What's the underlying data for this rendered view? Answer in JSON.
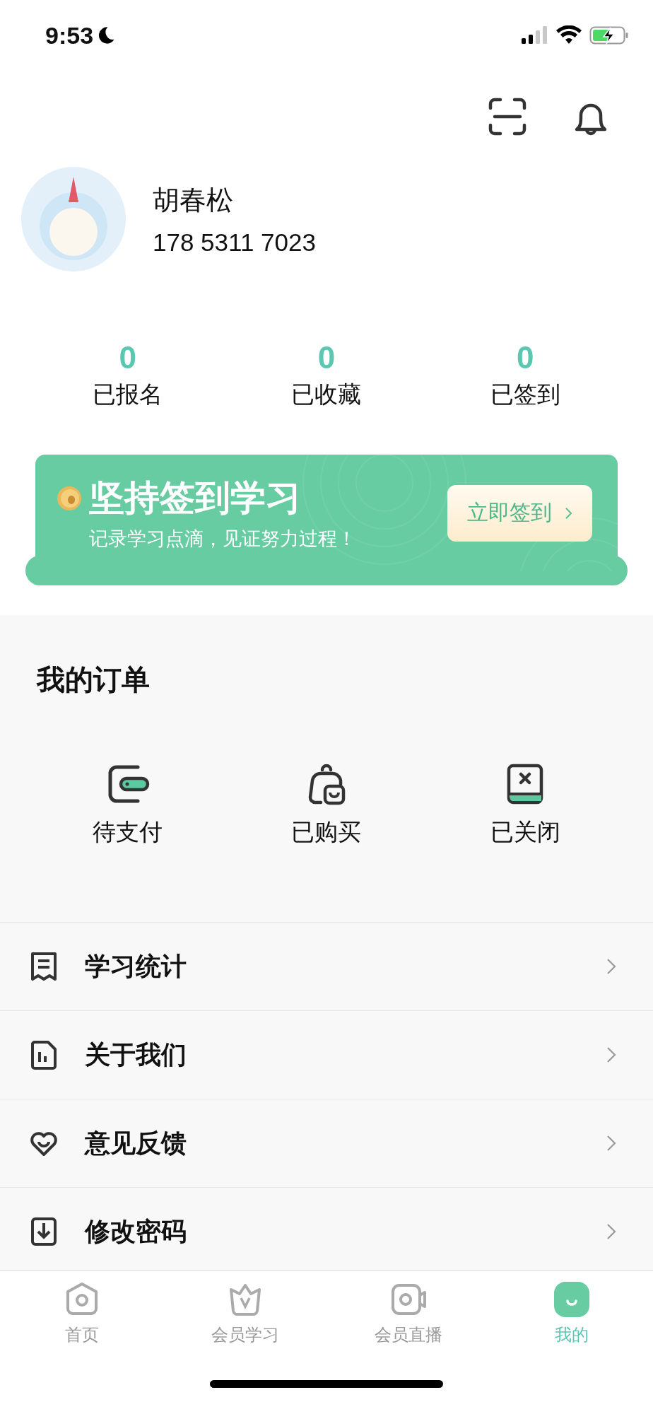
{
  "status_bar": {
    "time": "9:53"
  },
  "profile": {
    "name": "胡春松",
    "phone": "178 5311 7023"
  },
  "stats": [
    {
      "value": "0",
      "label": "已报名"
    },
    {
      "value": "0",
      "label": "已收藏"
    },
    {
      "value": "0",
      "label": "已签到"
    }
  ],
  "checkin_banner": {
    "title": "坚持签到学习",
    "subtitle": "记录学习点滴，见证努力过程！",
    "button": "立即签到"
  },
  "orders": {
    "title": "我的订单",
    "items": [
      {
        "kind": "wallet",
        "label": "待支付"
      },
      {
        "kind": "bag",
        "label": "已购买"
      },
      {
        "kind": "closed",
        "label": "已关闭"
      }
    ]
  },
  "menu": [
    {
      "kind": "receipt",
      "label": "学习统计"
    },
    {
      "kind": "chart",
      "label": "关于我们"
    },
    {
      "kind": "heart",
      "label": "意见反馈"
    },
    {
      "kind": "download",
      "label": "修改密码"
    }
  ],
  "tabs": [
    {
      "kind": "home",
      "label": "首页",
      "selected": false
    },
    {
      "kind": "crown",
      "label": "会员学习",
      "selected": false
    },
    {
      "kind": "video",
      "label": "会员直播",
      "selected": false
    },
    {
      "kind": "me",
      "label": "我的",
      "selected": true
    }
  ]
}
